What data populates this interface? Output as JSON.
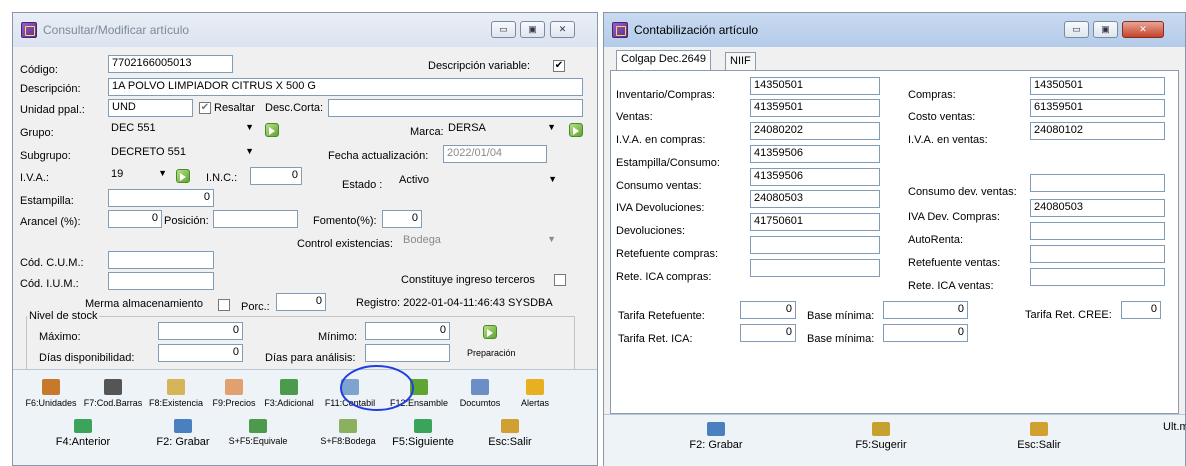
{
  "left_window": {
    "title": "Consultar/Modificar artículo",
    "buttons": {
      "minimize": "▭",
      "maximize": "▣",
      "close": "✕"
    },
    "codigo_label": "Código:",
    "codigo_value": "7702166005013",
    "desc_variable_label": "Descripción variable:",
    "desc_variable_checked": "✔",
    "descripcion_label": "Descripción:",
    "descripcion_value": "1A POLVO LIMPIADOR CITRUS X 500 G",
    "unidad_label": "Unidad ppal.:",
    "unidad_value": "UND",
    "resaltar_checked": "✔",
    "resaltar_label": "Resaltar",
    "desc_corta_label": "Desc.Corta:",
    "desc_corta_value": "",
    "grupo_label": "Grupo:",
    "grupo_value": "DEC 551",
    "marca_label": "Marca:",
    "marca_value": "DERSA",
    "subgrupo_label": "Subgrupo:",
    "subgrupo_value": "DECRETO 551",
    "fecha_act_label": "Fecha actualización:",
    "fecha_act_value": "2022/01/04",
    "iva_label": "I.V.A.:",
    "iva_value": "19",
    "inc_label": "I.N.C.:",
    "inc_value": "0",
    "estado_label": "Estado :",
    "estado_value": "Activo",
    "estampilla_label": "Estampilla:",
    "estampilla_value": "0",
    "arancel_label": "Arancel (%):",
    "arancel_value": "0",
    "posicion_label": "Posición:",
    "posicion_value": "",
    "fomento_label": "Fomento(%):",
    "fomento_value": "0",
    "control_exist_label": "Control existencias:",
    "control_exist_value": "Bodega",
    "cod_cum_label": "Cód. C.U.M.:",
    "cod_cum_value": "",
    "cod_ium_label": "Cód. I.U.M.:",
    "cod_ium_value": "",
    "constituye_label": "Constituye ingreso terceros",
    "merma_label": "Merma almacenamiento",
    "porc_label": "Porc.:",
    "porc_value": "0",
    "registro_text": "Registro: 2022-01-04-11:46:43 SYSDBA",
    "nivel_stock_label": "Nivel de stock",
    "maximo_label": "Máximo:",
    "maximo_value": "0",
    "minimo_label": "Mínimo:",
    "minimo_value": "0",
    "dias_disp_label": "Días disponibilidad:",
    "dias_disp_value": "0",
    "dias_analisis_label": "Días para análisis:",
    "dias_analisis_value": "",
    "preparacion_label": "Preparación",
    "toolbar1": [
      {
        "label": "F6:Unidades",
        "icon": "units-icon",
        "color": "#c8782a"
      },
      {
        "label": "F7:Cod.Barras",
        "icon": "barcode-icon",
        "color": "#555555"
      },
      {
        "label": "F8:Existencia",
        "icon": "clipboard-icon",
        "color": "#d8b458"
      },
      {
        "label": "F9:Precios",
        "icon": "price-tag-icon",
        "color": "#e0a070"
      },
      {
        "label": "F3:Adicional",
        "icon": "spreadsheet-icon",
        "color": "#4c9a4c"
      },
      {
        "label": "F11:Contabil",
        "icon": "ledger-icon",
        "color": "#7fa3cf"
      },
      {
        "label": "F12:Ensamble",
        "icon": "puzzle-icon",
        "color": "#5ea531"
      },
      {
        "label": "Documtos",
        "icon": "document-icon",
        "color": "#6b8fc4"
      },
      {
        "label": "Alertas",
        "icon": "warning-icon",
        "color": "#e8b020"
      }
    ],
    "toolbar2": [
      {
        "label": "F4:Anterior",
        "icon": "arrow-left-icon",
        "color": "#3aa55a"
      },
      {
        "label": "F2: Grabar",
        "icon": "save-icon",
        "color": "#4a7fc0"
      },
      {
        "label": "S+F5:Equivale",
        "icon": "equivalent-icon",
        "color": "#4c9a4c"
      },
      {
        "label": "S+F8:Bodega",
        "icon": "warehouse-icon",
        "color": "#8ab060"
      },
      {
        "label": "F5:Siguiente",
        "icon": "arrow-right-icon",
        "color": "#3aa55a"
      },
      {
        "label": "Esc:Salir",
        "icon": "exit-icon",
        "color": "#d0a030"
      }
    ],
    "highlight_color": "#1f3fe0"
  },
  "right_window": {
    "title": "Contabilización artículo",
    "buttons": {
      "minimize": "▭",
      "maximize": "▣",
      "close": "✕"
    },
    "tabs": [
      "Colgap Dec.2649",
      "NIIF"
    ],
    "left_fields": [
      {
        "label": "Inventario/Compras:",
        "value": "14350501"
      },
      {
        "label": "Ventas:",
        "value": "41359501"
      },
      {
        "label": "I.V.A. en compras:",
        "value": "24080202"
      },
      {
        "label": "Estampilla/Consumo:",
        "value": "41359506"
      },
      {
        "label": "Consumo ventas:",
        "value": "41359506"
      },
      {
        "label": "IVA Devoluciones:",
        "value": "24080503"
      },
      {
        "label": "Devoluciones:",
        "value": "41750601"
      },
      {
        "label": "Retefuente compras:",
        "value": ""
      },
      {
        "label": "Rete. ICA compras:",
        "value": ""
      }
    ],
    "right_fields": [
      {
        "label": "Compras:",
        "value": "14350501"
      },
      {
        "label": "Costo ventas:",
        "value": "61359501"
      },
      {
        "label": "I.V.A. en ventas:",
        "value": "24080102"
      },
      {
        "label": "Consumo dev. ventas:",
        "value": ""
      },
      {
        "label": "IVA Dev. Compras:",
        "value": "24080503"
      },
      {
        "label": "AutoRenta:",
        "value": ""
      },
      {
        "label": "Retefuente ventas:",
        "value": ""
      },
      {
        "label": "Rete. ICA ventas:",
        "value": ""
      }
    ],
    "tarifa_retefuente_label": "Tarifa Retefuente:",
    "tarifa_retefuente_value": "0",
    "base_minima_label": "Base mínima:",
    "base_minima_value": "0",
    "tarifa_cree_label": "Tarifa Ret. CREE:",
    "tarifa_cree_value": "0",
    "tarifa_ica_label": "Tarifa Ret. ICA:",
    "tarifa_ica_value": "0",
    "base_minima2_label": "Base mínima:",
    "base_minima2_value": "0",
    "toolbar": [
      {
        "label": "F2: Grabar",
        "icon": "save-icon",
        "color": "#4a7fc0"
      },
      {
        "label": "F5:Sugerir",
        "icon": "magic-wand-icon",
        "color": "#c8a030"
      },
      {
        "label": "Esc:Salir",
        "icon": "exit-icon",
        "color": "#d0a030"
      }
    ],
    "ult_label": "Ult.m"
  }
}
